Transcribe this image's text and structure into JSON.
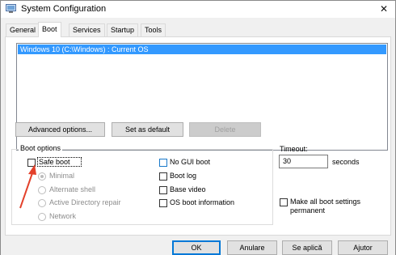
{
  "window": {
    "title": "System Configuration",
    "close": "✕"
  },
  "tabs": [
    "General",
    "Boot",
    "Services",
    "Startup",
    "Tools"
  ],
  "os_list": {
    "items": [
      "Windows 10 (C:\\Windows) : Current OS"
    ]
  },
  "buttons": {
    "advanced": "Advanced options...",
    "set_default": "Set as default",
    "delete": "Delete"
  },
  "boot_options": {
    "title": "Boot options",
    "safe_boot": "Safe boot",
    "minimal": "Minimal",
    "alternate_shell": "Alternate shell",
    "ad_repair": "Active Directory repair",
    "network": "Network",
    "no_gui_boot": "No GUI boot",
    "boot_log": "Boot log",
    "base_video": "Base video",
    "os_boot_info": "OS boot information"
  },
  "timeout": {
    "label": "Timeout:",
    "value": "30",
    "unit": "seconds"
  },
  "make_permanent": {
    "line1": "Make all boot settings",
    "line2": "permanent"
  },
  "footer": {
    "ok": "OK",
    "cancel": "Anulare",
    "apply": "Se aplică",
    "help": "Ajutor"
  },
  "colors": {
    "selection": "#3399ff",
    "arrow": "#e3412b"
  }
}
